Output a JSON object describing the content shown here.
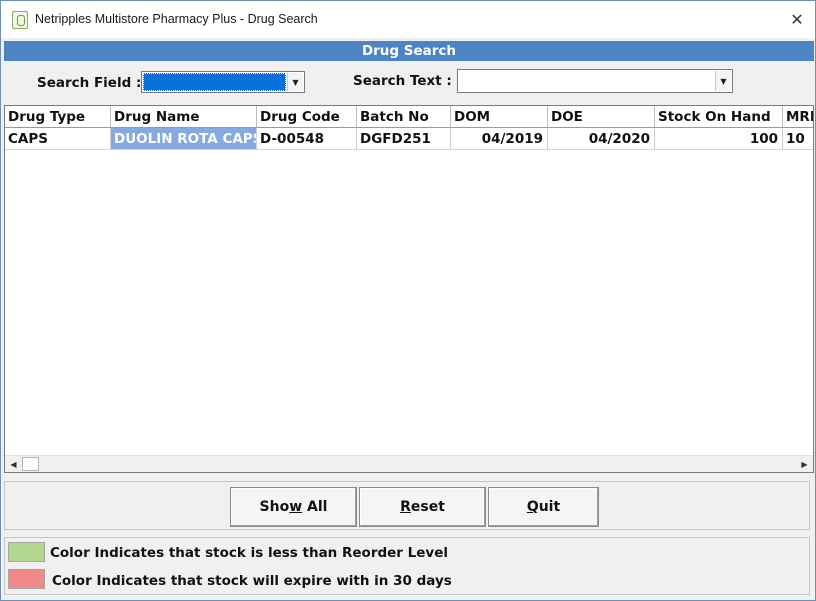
{
  "window": {
    "title": "Netripples Multistore Pharmacy Plus - Drug Search",
    "close_glyph": "✕"
  },
  "header": {
    "title": "Drug Search"
  },
  "search": {
    "field_label": "Search Field :",
    "field_value": "",
    "text_label": "Search Text :",
    "text_value": ""
  },
  "grid": {
    "columns": [
      "Drug Type",
      "Drug Name",
      "Drug Code",
      "Batch No",
      "DOM",
      "DOE",
      "Stock On Hand",
      "MRP"
    ],
    "rows": [
      {
        "drug_type": "CAPS",
        "drug_name": "DUOLIN ROTA CAPS",
        "drug_code": "D-00548",
        "batch_no": "DGFD251",
        "dom": "04/2019",
        "doe": "04/2020",
        "stock_on_hand": "100",
        "mrp": "10"
      }
    ]
  },
  "buttons": {
    "show_all_pre": "Sho",
    "show_all_hot": "w",
    "show_all_post": " All",
    "reset_hot": "R",
    "reset_post": "eset",
    "quit_hot": "Q",
    "quit_post": "uit"
  },
  "legend": {
    "low_stock_text": "Color Indicates that stock is less than Reorder Level",
    "expiry_text": "Color Indicates that stock will expire with in 30 days"
  },
  "colors": {
    "header_blue": "#4d84c4",
    "selection_blue": "#86a9e0",
    "low_stock_green": "#b4d78f",
    "expiry_red": "#f08a8a"
  },
  "icons": [
    "app-icon",
    "close-icon",
    "dropdown-arrow-icon",
    "scroll-left-icon",
    "scroll-right-icon"
  ]
}
